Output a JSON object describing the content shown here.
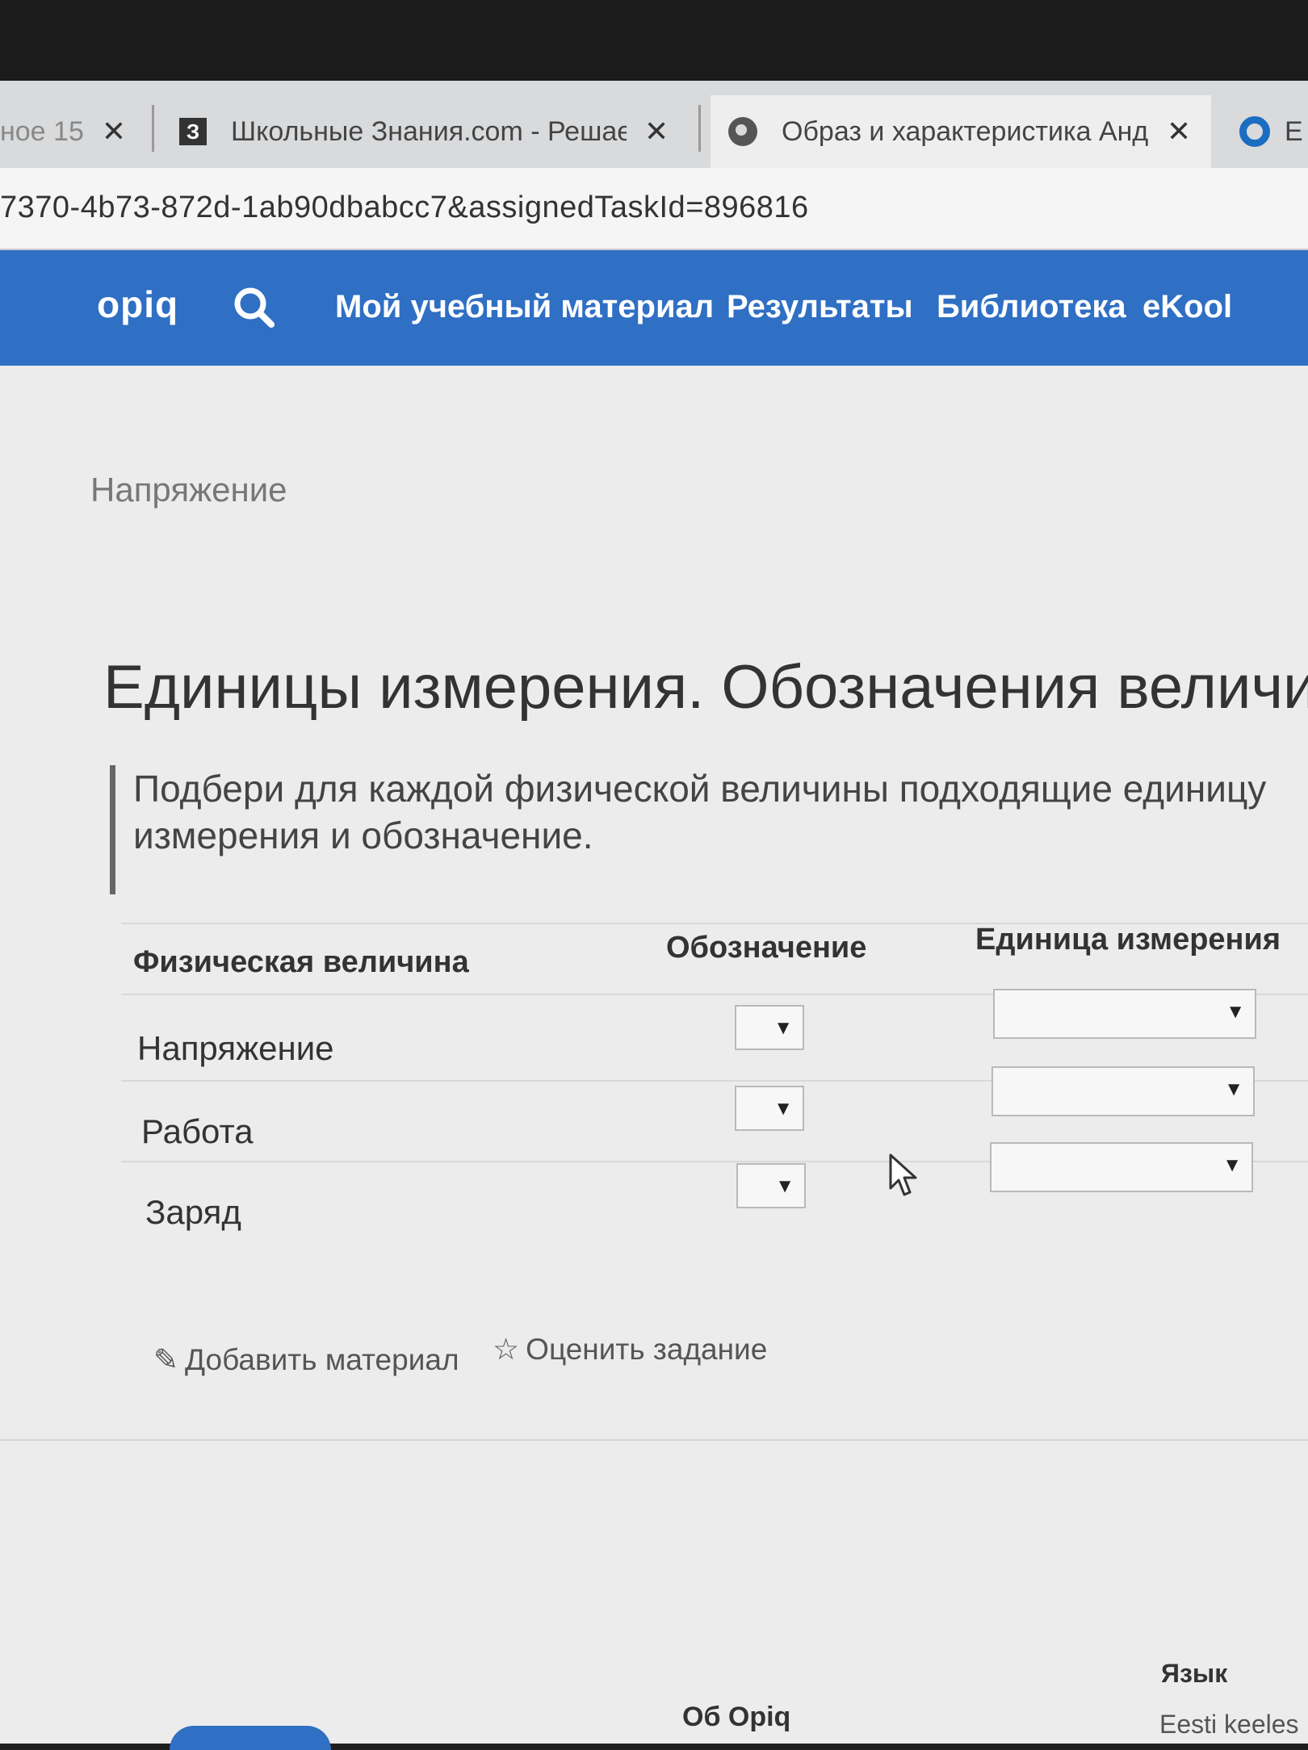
{
  "browser": {
    "tabs": [
      {
        "title": "ное 15",
        "close": "✕"
      },
      {
        "title": "Школьные Знания.com - Решае",
        "favicon": "З",
        "close": "✕"
      },
      {
        "title": "Образ и характеристика Андри",
        "close": "✕"
      },
      {
        "title": "Е"
      }
    ],
    "url": "7370-4b73-872d-1ab90dbabcc7&assignedTaskId=896816"
  },
  "nav": {
    "logo": "opiq",
    "search_icon": "search-icon",
    "items": [
      "Мой учебный материал",
      "Результаты",
      "Библиотека",
      "eKool"
    ],
    "color": "#2f6fc4"
  },
  "main": {
    "breadcrumb": "Напряжение",
    "title": "Единицы измерения. Обозначения величин",
    "instruction": [
      "Подбери для каждой физической величины подходящие единицу",
      "измерения и обозначение."
    ],
    "table": {
      "headers": [
        "Физическая величина",
        "Обозначение",
        "Единица измерения"
      ],
      "rows": [
        {
          "label": "Напряжение",
          "symbol": "",
          "unit": ""
        },
        {
          "label": "Работа",
          "symbol": "",
          "unit": ""
        },
        {
          "label": "Заряд",
          "symbol": "",
          "unit": ""
        }
      ],
      "caret": "▼"
    },
    "actions": {
      "add_material": "Добавить материал",
      "rate_task": "Оценить задание",
      "add_icon": "✎",
      "rate_icon": "☆"
    }
  },
  "footer": {
    "about": "Об Opiq",
    "language_label": "Язык",
    "language": "Eesti keeles"
  }
}
